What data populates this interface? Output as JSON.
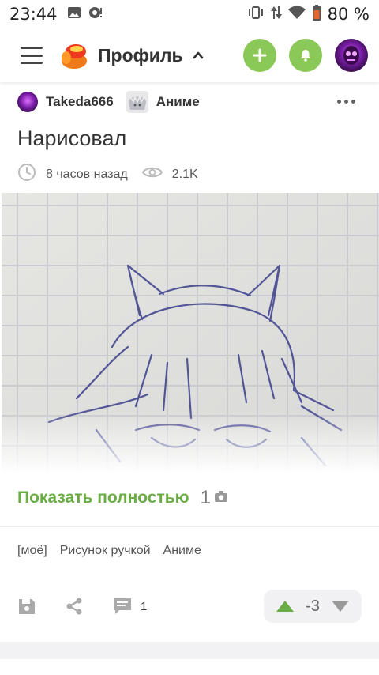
{
  "status_bar": {
    "time": "23:44",
    "battery": "80 %"
  },
  "header": {
    "title": "Профиль",
    "colors": {
      "accent": "#8ac858"
    }
  },
  "post": {
    "author": "Takeda666",
    "community": "Аниме",
    "title": "Нарисовал",
    "time_ago": "8 часов назад",
    "views": "2.1K",
    "show_more": "Показать полностью",
    "photo_count": "1",
    "tags": [
      "[моё]",
      "Рисунок ручкой",
      "Аниме"
    ],
    "comments": "1",
    "rating": "-3"
  },
  "icons": {
    "status": [
      "image-icon",
      "notification-icon",
      "vibrate-icon",
      "data-arrows-icon",
      "wifi-icon",
      "battery-icon"
    ],
    "header": [
      "menu-icon",
      "app-logo",
      "chevron-up-icon",
      "plus-icon",
      "bell-icon",
      "avatar"
    ],
    "post": [
      "clock-icon",
      "eye-icon",
      "camera-icon",
      "more-icon",
      "save-icon",
      "share-icon",
      "comment-icon",
      "upvote-icon",
      "downvote-icon"
    ]
  }
}
